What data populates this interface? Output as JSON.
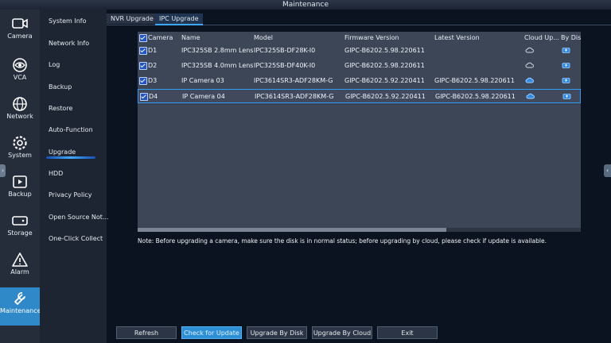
{
  "window": {
    "title": "Maintenance"
  },
  "rail": [
    {
      "label": "Camera",
      "icon": "camera-icon"
    },
    {
      "label": "VCA",
      "icon": "vca-icon"
    },
    {
      "label": "Network",
      "icon": "globe-icon"
    },
    {
      "label": "System",
      "icon": "gear-icon"
    },
    {
      "label": "Backup",
      "icon": "playback-icon"
    },
    {
      "label": "Storage",
      "icon": "hdd-icon"
    },
    {
      "label": "Alarm",
      "icon": "warning-icon"
    },
    {
      "label": "Maintenance",
      "icon": "wrench-icon",
      "active": true
    }
  ],
  "submenu": [
    "System Info",
    "Network Info",
    "Log",
    "Backup",
    "Restore",
    "Auto-Function",
    "Upgrade",
    "HDD",
    "Privacy Policy",
    "Open Source Not...",
    "One-Click Collect"
  ],
  "tabs": [
    "NVR Upgrade",
    "IPC Upgrade"
  ],
  "table": {
    "headers": [
      "Camera",
      "Name",
      "Model",
      "Firmware Version",
      "Latest Version",
      "Cloud Up...",
      "By Dis"
    ],
    "rows": [
      {
        "camera": "D1",
        "name": "IPC325SB 2.8mm Lens",
        "model": "IPC325SB-DF28K-I0",
        "firmware": "GIPC-B6202.5.98.220611",
        "latest": ""
      },
      {
        "camera": "D2",
        "name": "IPC325SB 4.0mm Lens",
        "model": "IPC325SB-DF40K-I0",
        "firmware": "GIPC-B6202.5.98.220611",
        "latest": ""
      },
      {
        "camera": "D3",
        "name": "IP Camera 03",
        "model": "IPC3614SR3-ADF28KM-G",
        "firmware": "GIPC-B6202.5.92.220411",
        "latest": "GIPC-B6202.5.98.220611"
      },
      {
        "camera": "D4",
        "name": "IP Camera 04",
        "model": "IPC3614SR3-ADF28KM-G",
        "firmware": "GIPC-B6202.5.92.220411",
        "latest": "GIPC-B6202.5.98.220611"
      }
    ]
  },
  "note": "Note: Before upgrading a camera, make sure the disk is in normal status; before upgrading by cloud, please check if update is available.",
  "buttons": {
    "refresh": "Refresh",
    "check_update": "Check for Update",
    "upgrade_disk": "Upgrade By Disk",
    "upgrade_cloud": "Upgrade By Cloud",
    "exit": "Exit"
  },
  "colors": {
    "accent": "#2d8fd6",
    "highlight_border": "#2e9cf0"
  }
}
